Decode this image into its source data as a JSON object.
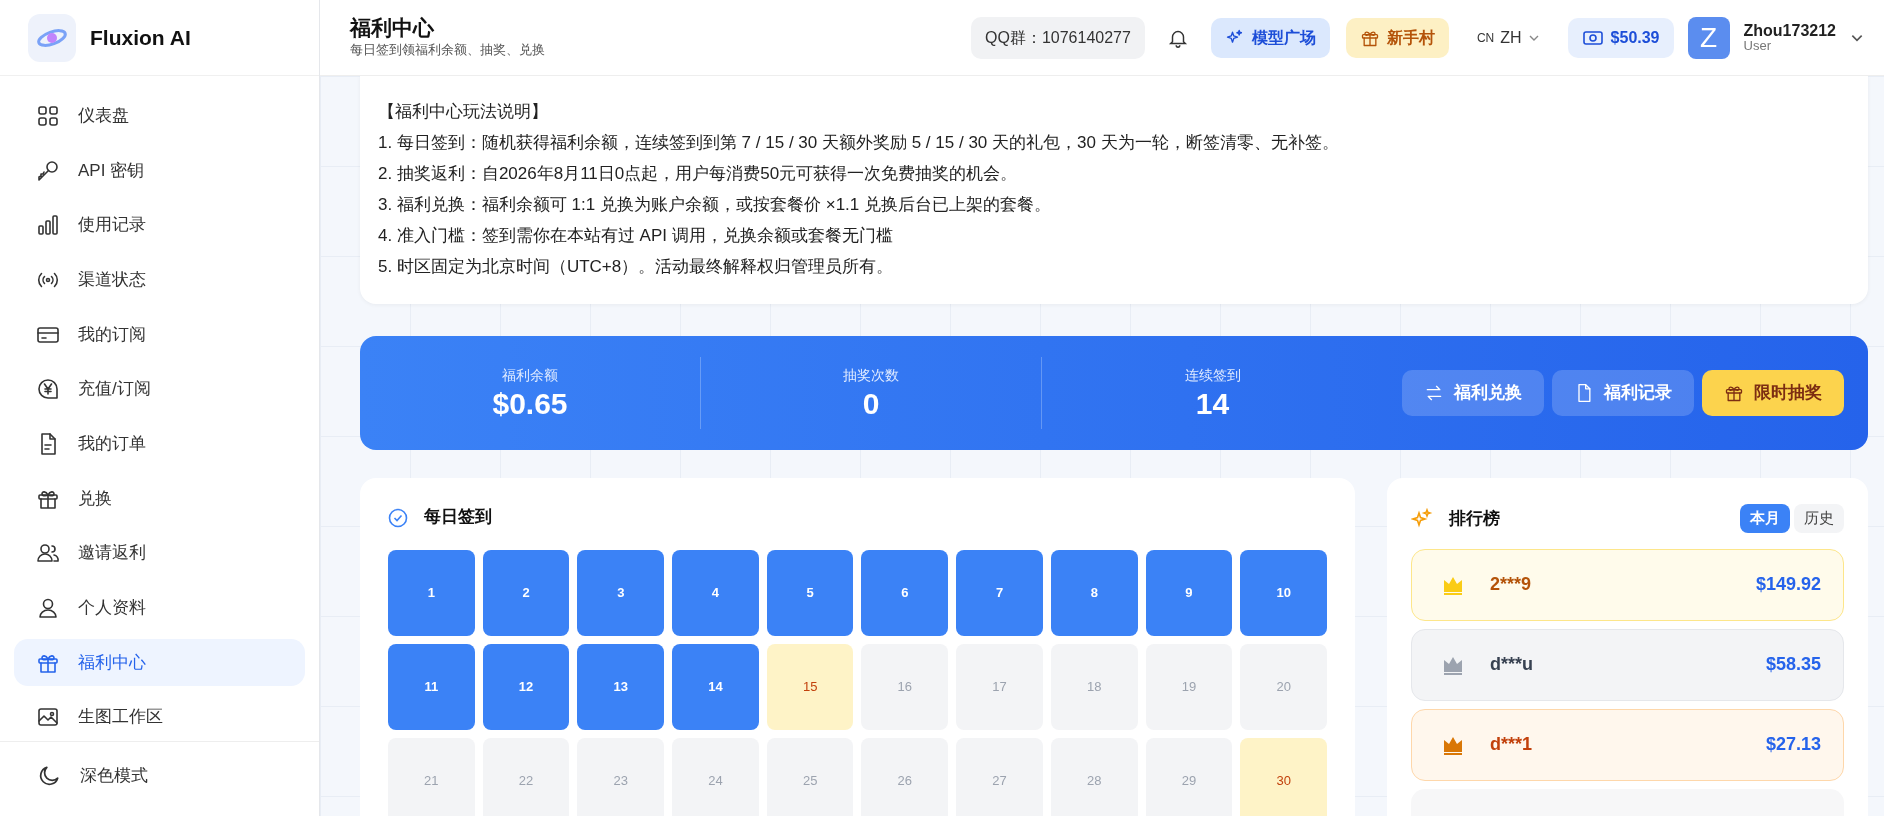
{
  "brand": {
    "name": "Fluxion AI"
  },
  "sidebar": {
    "items": [
      {
        "kind": "dashboard",
        "label": "仪表盘",
        "selected": false
      },
      {
        "kind": "key",
        "label": "API 密钥",
        "selected": false
      },
      {
        "kind": "chart",
        "label": "使用记录",
        "selected": false
      },
      {
        "kind": "signal",
        "label": "渠道状态",
        "selected": false
      },
      {
        "kind": "card",
        "label": "我的订阅",
        "selected": false
      },
      {
        "kind": "yen",
        "label": "充值/订阅",
        "selected": false
      },
      {
        "kind": "doc",
        "label": "我的订单",
        "selected": false
      },
      {
        "kind": "gift",
        "label": "兑换",
        "selected": false
      },
      {
        "kind": "users",
        "label": "邀请返利",
        "selected": false
      },
      {
        "kind": "user",
        "label": "个人资料",
        "selected": false
      },
      {
        "kind": "gift",
        "label": "福利中心",
        "selected": true
      },
      {
        "kind": "image",
        "label": "生图工作区",
        "selected": false
      }
    ],
    "footer": {
      "kind": "moon",
      "label": "深色模式"
    }
  },
  "header": {
    "title": "福利中心",
    "subtitle": "每日签到领福利余额、抽奖、兑换",
    "qq_group": "QQ群：1076140277",
    "buttons": [
      {
        "kind": "models",
        "label": "模型广场"
      },
      {
        "kind": "newbie",
        "label": "新手村"
      }
    ],
    "language": {
      "region": "CN",
      "code": "ZH"
    },
    "balance": "$50.39",
    "user": {
      "initial": "Z",
      "name": "Zhou173212",
      "role": "User"
    }
  },
  "rules": {
    "title": "【福利中心玩法说明】",
    "lines": [
      "1. 每日签到：随机获得福利余额，连续签到到第 7 / 15 / 30 天额外奖励 5 / 15 / 30 天的礼包，30 天为一轮，断签清零、无补签。",
      "2. 抽奖返利：自2026年8月11日0点起，用户每消费50元可获得一次免费抽奖的机会。",
      "3. 福利兑换：福利余额可 1:1 兑换为账户余额，或按套餐价 ×1.1 兑换后台已上架的套餐。",
      "4. 准入门槛：签到需你在本站有过 API 调用，兑换余额或套餐无门槛",
      "5. 时区固定为北京时间（UTC+8）。活动最终解释权归管理员所有。"
    ]
  },
  "stats": [
    {
      "label": "福利余额",
      "value": "$0.65"
    },
    {
      "label": "抽奖次数",
      "value": "0"
    },
    {
      "label": "连续签到",
      "value": "14"
    }
  ],
  "actions": [
    {
      "kind": "exchange",
      "label": "福利兑换"
    },
    {
      "kind": "records",
      "label": "福利记录"
    },
    {
      "kind": "lottery",
      "label": "限时抽奖"
    }
  ],
  "checkin": {
    "title": "每日签到",
    "days": [
      {
        "day": "1",
        "checked": true,
        "milestone": false
      },
      {
        "day": "2",
        "checked": true,
        "milestone": false
      },
      {
        "day": "3",
        "checked": true,
        "milestone": false
      },
      {
        "day": "4",
        "checked": true,
        "milestone": false
      },
      {
        "day": "5",
        "checked": true,
        "milestone": false
      },
      {
        "day": "6",
        "checked": true,
        "milestone": false
      },
      {
        "day": "7",
        "checked": true,
        "milestone": false
      },
      {
        "day": "8",
        "checked": true,
        "milestone": false
      },
      {
        "day": "9",
        "checked": true,
        "milestone": false
      },
      {
        "day": "10",
        "checked": true,
        "milestone": false
      },
      {
        "day": "11",
        "checked": true,
        "milestone": false
      },
      {
        "day": "12",
        "checked": true,
        "milestone": false
      },
      {
        "day": "13",
        "checked": true,
        "milestone": false
      },
      {
        "day": "14",
        "checked": true,
        "milestone": false
      },
      {
        "day": "15",
        "checked": false,
        "milestone": true
      },
      {
        "day": "16",
        "checked": false,
        "milestone": false
      },
      {
        "day": "17",
        "checked": false,
        "milestone": false
      },
      {
        "day": "18",
        "checked": false,
        "milestone": false
      },
      {
        "day": "19",
        "checked": false,
        "milestone": false
      },
      {
        "day": "20",
        "checked": false,
        "milestone": false
      },
      {
        "day": "21",
        "checked": false,
        "milestone": false
      },
      {
        "day": "22",
        "checked": false,
        "milestone": false
      },
      {
        "day": "23",
        "checked": false,
        "milestone": false
      },
      {
        "day": "24",
        "checked": false,
        "milestone": false
      },
      {
        "day": "25",
        "checked": false,
        "milestone": false
      },
      {
        "day": "26",
        "checked": false,
        "milestone": false
      },
      {
        "day": "27",
        "checked": false,
        "milestone": false
      },
      {
        "day": "28",
        "checked": false,
        "milestone": false
      },
      {
        "day": "29",
        "checked": false,
        "milestone": false
      },
      {
        "day": "30",
        "checked": false,
        "milestone": true
      }
    ]
  },
  "leaderboard": {
    "title": "排行榜",
    "tabs": [
      {
        "label": "本月",
        "selected": true
      },
      {
        "label": "历史",
        "selected": false
      }
    ],
    "rows": [
      {
        "kind": "gold",
        "user": "2***9",
        "amount": "$149.92"
      },
      {
        "kind": "silver",
        "user": "d***u",
        "amount": "$58.35"
      },
      {
        "kind": "bronze",
        "user": "d***1",
        "amount": "$27.13"
      }
    ]
  }
}
